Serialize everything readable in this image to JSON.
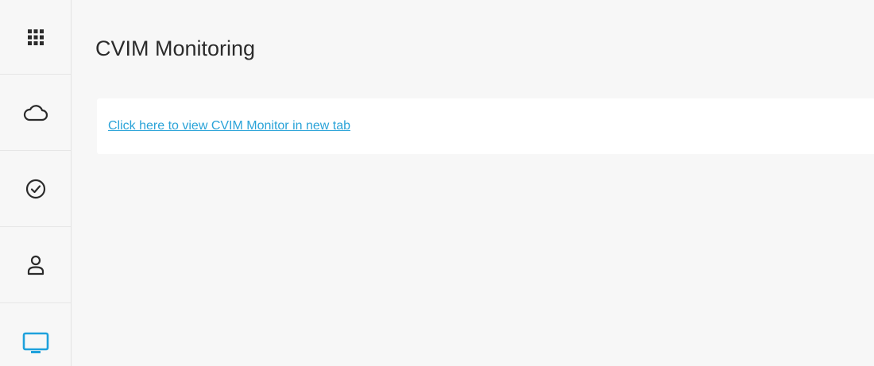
{
  "sidebar": {
    "items": [
      {
        "icon": "apps-grid-icon",
        "active": false
      },
      {
        "icon": "cloud-icon",
        "active": false
      },
      {
        "icon": "check-circle-icon",
        "active": false
      },
      {
        "icon": "user-icon",
        "active": false
      },
      {
        "icon": "monitor-icon",
        "active": true
      }
    ],
    "icon_color": "#2b2b2b",
    "active_color": "#1ea1dc"
  },
  "page": {
    "title": "CVIM Monitoring"
  },
  "card": {
    "link_text": "Click here to view CVIM Monitor in new tab",
    "link_color": "#2aa3d8"
  }
}
